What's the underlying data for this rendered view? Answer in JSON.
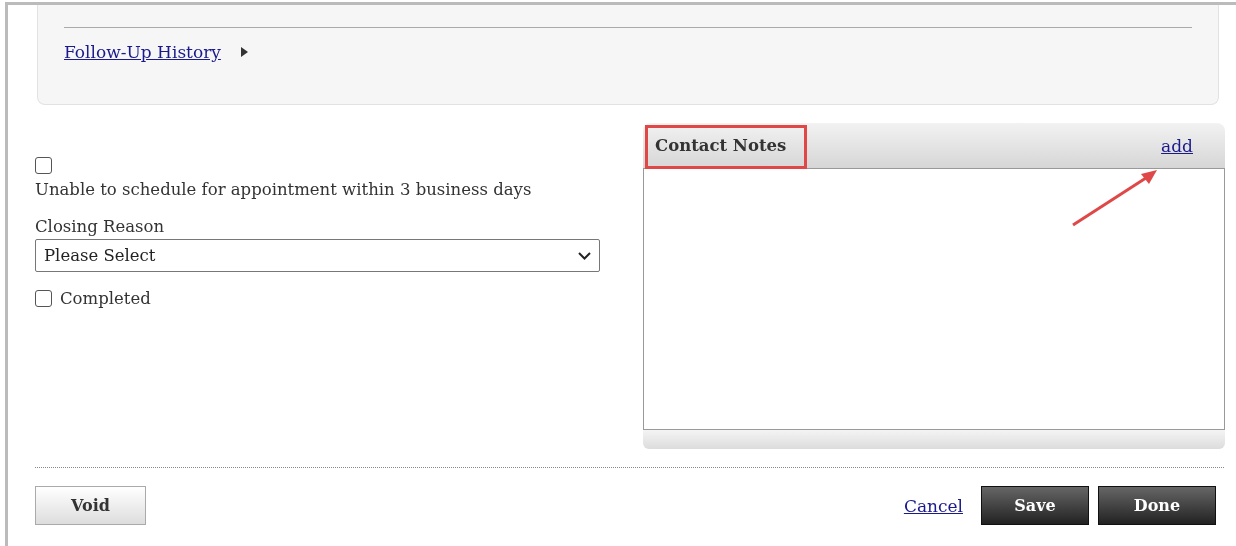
{
  "history": {
    "label": "Follow-Up History",
    "expanded": false
  },
  "options": [
    {
      "kind": "stacked",
      "label": "Unable to schedule for appointment within 3 business days",
      "checked": false
    }
  ],
  "closing_reason": {
    "label": "Closing Reason",
    "value": "Please Select"
  },
  "completed": {
    "kind": "inline",
    "label": "Completed",
    "checked": false
  },
  "contact_notes": {
    "title": "Contact Notes",
    "action": "add"
  },
  "footer": {
    "void": "Void",
    "cancel": "Cancel",
    "save": "Save",
    "done": "Done"
  }
}
